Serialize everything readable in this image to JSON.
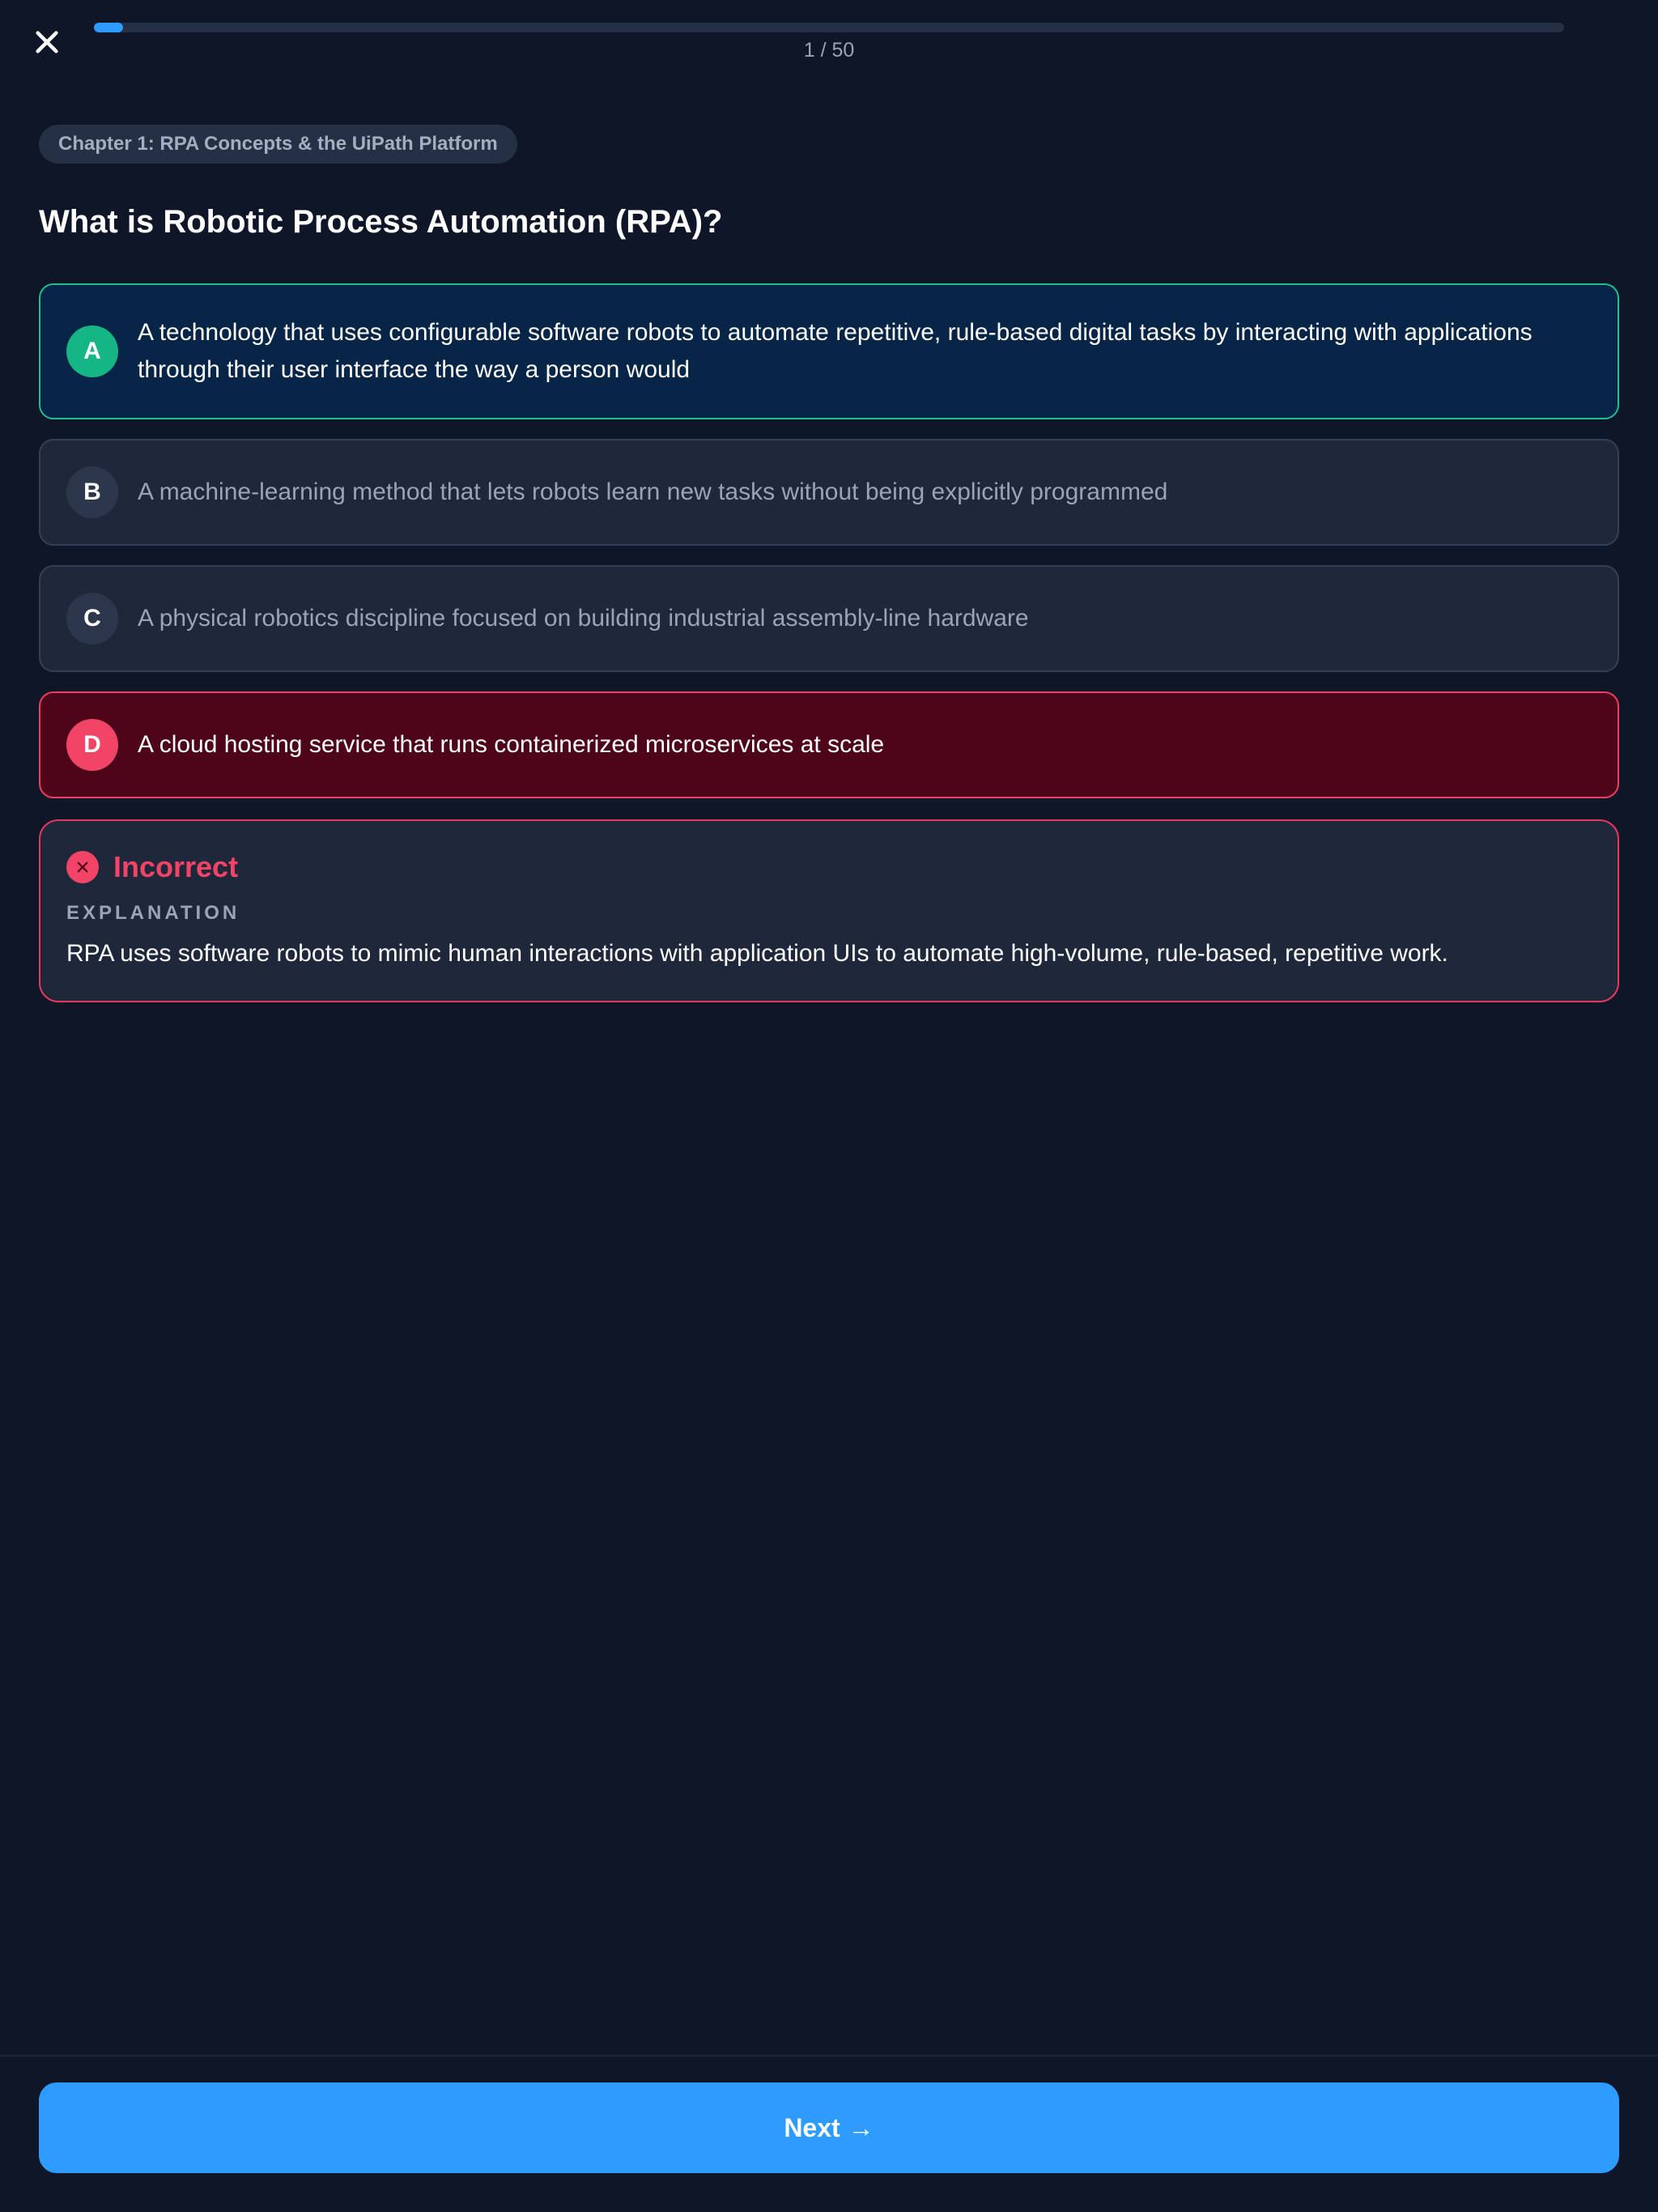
{
  "header": {
    "close_icon": "close-icon",
    "progress": {
      "current": 1,
      "total": 50,
      "label": "1 / 50"
    }
  },
  "question": {
    "chapter": "Chapter 1: RPA Concepts & the UiPath Platform",
    "text": "What is Robotic Process Automation (RPA)?",
    "options": [
      {
        "letter": "A",
        "text": "A technology that uses configurable software robots to automate repetitive, rule-based digital tasks by interacting with applications through their user interface the way a person would",
        "state": "correct"
      },
      {
        "letter": "B",
        "text": "A machine-learning method that lets robots learn new tasks without being explicitly programmed",
        "state": "neutral"
      },
      {
        "letter": "C",
        "text": "A physical robotics discipline focused on building industrial assembly-line hardware",
        "state": "neutral"
      },
      {
        "letter": "D",
        "text": "A cloud hosting service that runs containerized microservices at scale",
        "state": "wrong"
      }
    ]
  },
  "feedback": {
    "icon": "x-circle-icon",
    "title": "Incorrect",
    "explanation_label": "EXPLANATION",
    "explanation": "RPA uses software robots to mimic human interactions with application UIs to automate high-volume, rule-based, repetitive work."
  },
  "footer": {
    "next_label": "Next",
    "next_arrow": "→"
  },
  "colors": {
    "background": "#0e1628",
    "accent": "#2e9bff",
    "correct": "#15b584",
    "wrong": "#f24466"
  }
}
